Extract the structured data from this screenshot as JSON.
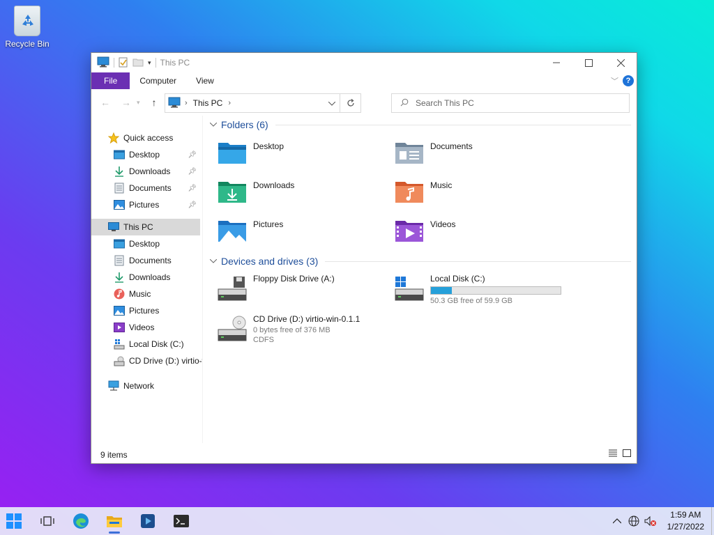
{
  "desktop": {
    "recycle_bin_label": "Recycle Bin"
  },
  "window": {
    "title": "This PC",
    "ribbon_tabs": [
      "File",
      "Computer",
      "View"
    ],
    "address": {
      "crumb": "This PC"
    },
    "search": {
      "placeholder": "Search This PC"
    }
  },
  "nav": {
    "quick_access": "Quick access",
    "quick_items": [
      "Desktop",
      "Downloads",
      "Documents",
      "Pictures"
    ],
    "this_pc": "This PC",
    "pc_items": [
      "Desktop",
      "Documents",
      "Downloads",
      "Music",
      "Pictures",
      "Videos",
      "Local Disk (C:)",
      "CD Drive (D:) virtio-win-0.1.1"
    ],
    "network": "Network"
  },
  "folders": {
    "header": "Folders (6)",
    "items": [
      {
        "name": "Desktop",
        "icon": "desktop-folder-icon"
      },
      {
        "name": "Documents",
        "icon": "documents-folder-icon"
      },
      {
        "name": "Downloads",
        "icon": "downloads-folder-icon"
      },
      {
        "name": "Music",
        "icon": "music-folder-icon"
      },
      {
        "name": "Pictures",
        "icon": "pictures-folder-icon"
      },
      {
        "name": "Videos",
        "icon": "videos-folder-icon"
      }
    ]
  },
  "drives": {
    "header": "Devices and drives (3)",
    "items": [
      {
        "name": "Floppy Disk Drive (A:)",
        "sub1": "",
        "sub2": ""
      },
      {
        "name": "Local Disk (C:)",
        "sub1": "50.3 GB free of 59.9 GB",
        "sub2": "",
        "used_fraction": 0.16
      },
      {
        "name": "CD Drive (D:) virtio-win-0.1.1",
        "sub1": "0 bytes free of 376 MB",
        "sub2": "CDFS"
      }
    ]
  },
  "status": {
    "count": "9 items"
  },
  "taskbar": {
    "time": "1:59 AM",
    "date": "1/27/2022"
  },
  "colors": {
    "file_tab": "#6b2fb3",
    "accent": "#1e4e9a",
    "bar_fill": "#26a0da"
  }
}
